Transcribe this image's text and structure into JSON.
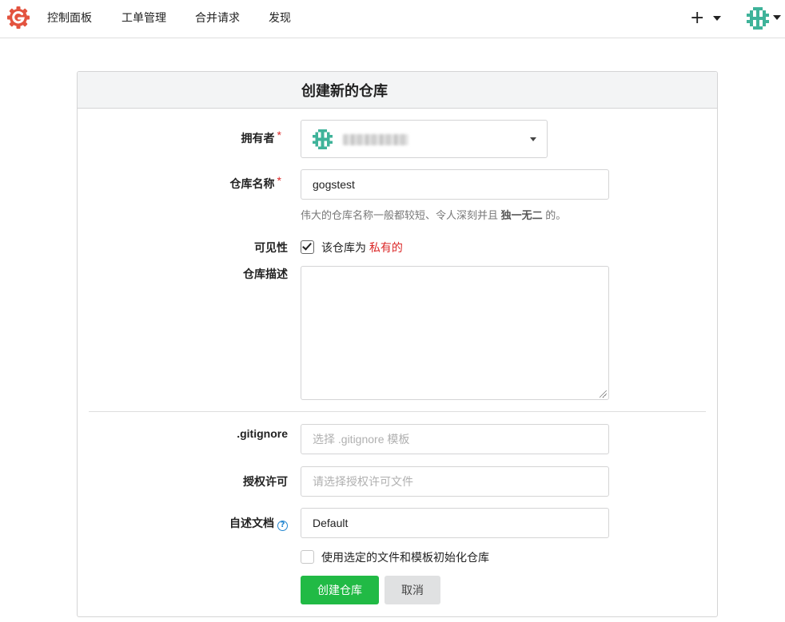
{
  "nav": {
    "items": [
      "控制面板",
      "工单管理",
      "合并请求",
      "发现"
    ],
    "plus": "+"
  },
  "form": {
    "title": "创建新的仓库",
    "owner_label": "拥有者",
    "required_mark": "*",
    "repo_name_label": "仓库名称",
    "repo_name_value": "gogstest",
    "repo_name_help_prefix": "伟大的仓库名称一般都较短、令人深刻并且",
    "repo_name_help_bold": "独一无二",
    "repo_name_help_suffix": "的。",
    "visibility_label": "可见性",
    "visibility_checked": true,
    "visibility_text": "该仓库为",
    "visibility_private": "私有的",
    "description_label": "仓库描述",
    "description_value": "",
    "gitignore_label": ".gitignore",
    "gitignore_placeholder": "选择 .gitignore 模板",
    "license_label": "授权许可",
    "license_placeholder": "请选择授权许可文件",
    "readme_label": "自述文档",
    "help_icon": "?",
    "readme_value": "Default",
    "auto_init_checked": false,
    "auto_init_text": "使用选定的文件和模板初始化仓库",
    "create_button": "创建仓库",
    "cancel_button": "取消"
  },
  "colors": {
    "brand": "#e3533f",
    "primary_green": "#21ba45",
    "private_red": "#db2828",
    "help_blue": "#2185d0",
    "identicon": "#3fb39a"
  },
  "icons": {
    "logo": "gogs-logo-icon",
    "plus": "plus-icon",
    "caret": "caret-down-icon",
    "avatar": "identicon-avatar-icon",
    "help": "question-circle-icon",
    "check": "checkmark-icon"
  }
}
